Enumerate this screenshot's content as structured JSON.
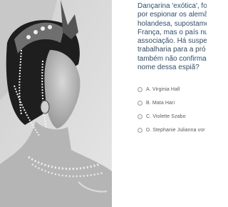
{
  "question": {
    "lines": [
      "Dançarina 'exótica', fo",
      "por espionar os alemã",
      "holandesa, supostame",
      "França, mas o país nu",
      "associação. Há suspei",
      "trabalharia para a pró",
      "também não confirma",
      "nome dessa espiã?"
    ]
  },
  "options": [
    {
      "label": "A. Virginia Hall"
    },
    {
      "label": "B. Mata Hari"
    },
    {
      "label": "C. Violette Szabo"
    },
    {
      "label": "D. Stephanie Julianna vor"
    }
  ]
}
